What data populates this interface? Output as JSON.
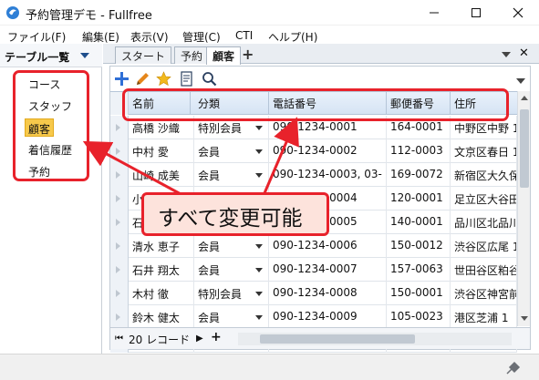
{
  "window": {
    "title": "予約管理デモ - Fullfree",
    "min": "—",
    "max": "☐",
    "close": "✕"
  },
  "menu": [
    "ファイル(F)",
    "編集(E)",
    "表示(V)",
    "管理(C)",
    "CTI",
    "ヘルプ(H)"
  ],
  "sidebar": {
    "title": "テーブル一覧",
    "items": [
      "コース",
      "スタッフ",
      "顧客",
      "着信履歴",
      "予約"
    ],
    "selected_index": 2
  },
  "tabs": {
    "items": [
      "スタート",
      "予約",
      "顧客"
    ],
    "active_index": 2,
    "add": "+",
    "close": "✕"
  },
  "toolbar": {
    "icons": [
      "add-icon",
      "edit-icon",
      "star-icon",
      "report-icon",
      "search-icon"
    ],
    "colors": {
      "add": "#2f6fd6",
      "edit": "#e5861b",
      "star": "#f2b91d"
    }
  },
  "grid": {
    "columns": [
      "名前",
      "分類",
      "電話番号",
      "郵便番号",
      "住所"
    ],
    "rows": [
      [
        "高橋 沙織",
        "特別会員",
        "090-1234-0001",
        "164-0001",
        "中野区中野 1"
      ],
      [
        "中村 愛",
        "会員",
        "090-1234-0002",
        "112-0003",
        "文京区春日 1"
      ],
      [
        "山崎 成美",
        "会員",
        "090-1234-0003, 03-",
        "169-0072",
        "新宿区大久保"
      ],
      [
        "小",
        "",
        "090-1234-0004",
        "120-0001",
        "足立区大谷田"
      ],
      [
        "石",
        "",
        "090-1234-0005",
        "140-0001",
        "品川区北品川"
      ],
      [
        "清水 恵子",
        "会員",
        "090-1234-0006",
        "150-0012",
        "渋谷区広尾 1"
      ],
      [
        "石井 翔太",
        "会員",
        "090-1234-0007",
        "157-0063",
        "世田谷区粕谷"
      ],
      [
        "木村 徹",
        "特別会員",
        "090-1234-0008",
        "150-0001",
        "渋谷区神宮前"
      ],
      [
        "鈴木 健太",
        "会員",
        "090-1234-0009",
        "105-0023",
        "港区芝浦 1"
      ],
      [
        "",
        "",
        "",
        "",
        ""
      ]
    ],
    "record_count": "20 レコード"
  },
  "footer": {
    "first": "⏮",
    "next": "▶",
    "add": "+"
  },
  "annotation": {
    "callout": "すべて変更可能",
    "color": "#e8222b"
  }
}
